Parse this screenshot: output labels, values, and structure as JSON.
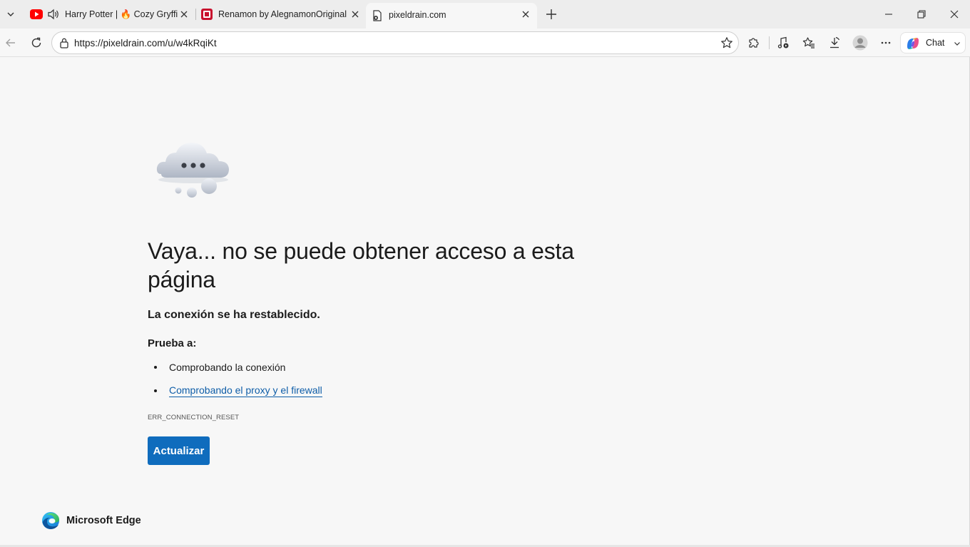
{
  "tabs": [
    {
      "title": "Harry Potter | 🔥 Cozy Gryffindor",
      "audio": true,
      "favicon": "youtube-icon",
      "active": false
    },
    {
      "title": "Renamon by AlegnamonOriginal (g",
      "favicon": "deviantart-icon",
      "active": false
    },
    {
      "title": "pixeldrain.com",
      "favicon": "page-error-icon",
      "active": true
    }
  ],
  "toolbar": {
    "url": "https://pixeldrain.com/u/w4kRqiKt",
    "chat_label": "Chat"
  },
  "error_page": {
    "title": "Vaya... no se puede obtener acceso a esta página",
    "subtitle": "La conexión se ha restablecido.",
    "try_label": "Prueba a:",
    "suggestions": [
      "Comprobando la conexión",
      "Comprobando el proxy y el firewall"
    ],
    "error_code": "ERR_CONNECTION_RESET",
    "reload_label": "Actualizar",
    "brand": "Microsoft Edge"
  },
  "colors": {
    "accent": "#0f6cbd",
    "link": "#0f5ea8",
    "page_bg": "#f7f7f7",
    "tabstrip_bg": "#ededed"
  }
}
